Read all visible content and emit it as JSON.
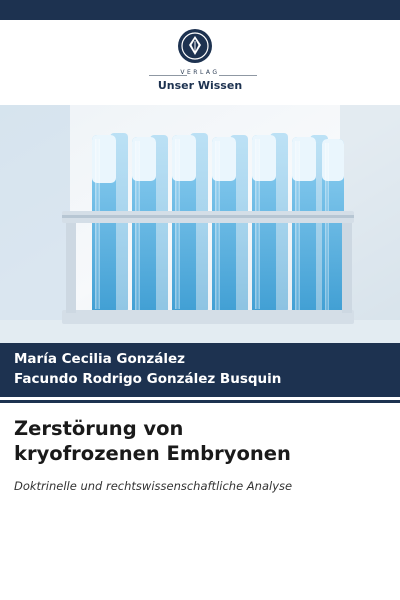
{
  "publisher": {
    "imprint_label": "VERLAG",
    "name": "Unser Wissen",
    "colors": {
      "brand": "#1d3250",
      "accent": "#2d3e55"
    }
  },
  "photo": {
    "icon": "test-tubes-photo",
    "colors": {
      "liquid": "#62b8e6",
      "rack": "#c9d6e1"
    }
  },
  "authors": [
    "María Cecilia González",
    "Facundo Rodrigo González Busquin"
  ],
  "book": {
    "title_line_1": "Zerstörung von",
    "title_line_2": "kryofrozenen Embryonen",
    "subtitle": "Doktrinelle und rechtswissenschaftliche Analyse"
  }
}
